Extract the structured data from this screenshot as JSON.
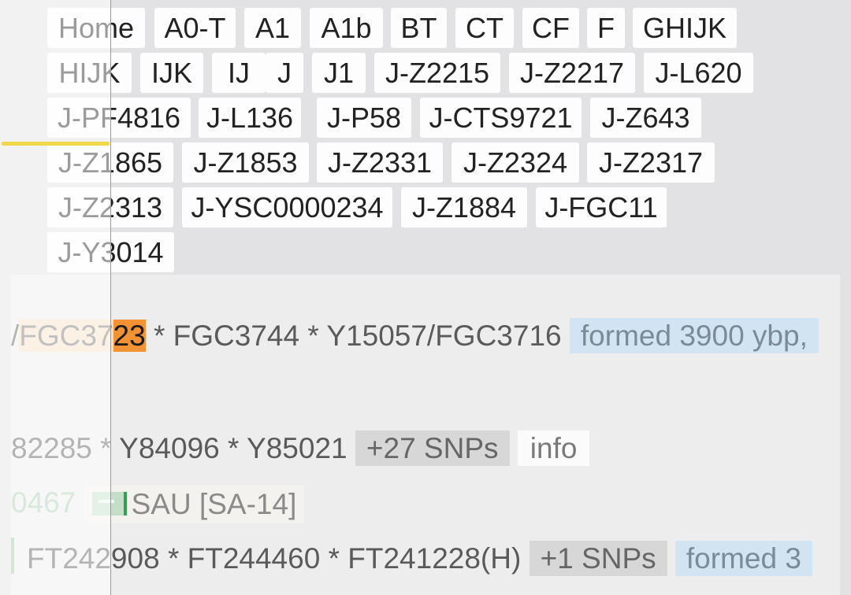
{
  "breadcrumbs": {
    "row1": [
      "Home",
      "A0-T",
      "A1",
      "A1b",
      "BT",
      "CT",
      "CF",
      "F",
      "GHIJK"
    ],
    "row2": [
      "HIJK",
      "IJK",
      "IJ",
      "J",
      "J1",
      "J-Z2215",
      "J-Z2217",
      "J-L620"
    ],
    "row3": [
      "J-PF4816",
      "J-L136",
      "J-P58",
      "J-CTS9721",
      "J-Z643"
    ],
    "row4": [
      "J-Z1865",
      "J-Z1853",
      "J-Z2331",
      "J-Z2324",
      "J-Z2317"
    ],
    "row5": [
      "J-Z2313",
      "J-YSC0000234",
      "J-Z1884",
      "J-FGC11"
    ],
    "row6": [
      "J-Y3014"
    ]
  },
  "tree": {
    "line1": {
      "prefix": "/",
      "snp_light": "FGC37",
      "snp_strong": "23",
      "rest": " * FGC3744 * Y15057/FGC3716 ",
      "formed": "formed 3900 ybp,"
    },
    "line2": {
      "text": "82285 * Y84096 * Y85021 ",
      "snps_badge": "+27 SNPs",
      "info": "info"
    },
    "line3": {
      "id": "0467",
      "country": "SAU [SA-14]"
    },
    "line4": {
      "text": "FT242908 * FT244460 * FT241228(H) ",
      "snps_badge": "+1 SNPs",
      "formed": "formed 3"
    }
  },
  "colors": {
    "highlight_strong": "#f39234",
    "highlight_light": "#f7dfc4",
    "formed_badge": "#d2e3f1",
    "snp_badge": "#d7d7d7",
    "indicator": "#f0d84a"
  }
}
